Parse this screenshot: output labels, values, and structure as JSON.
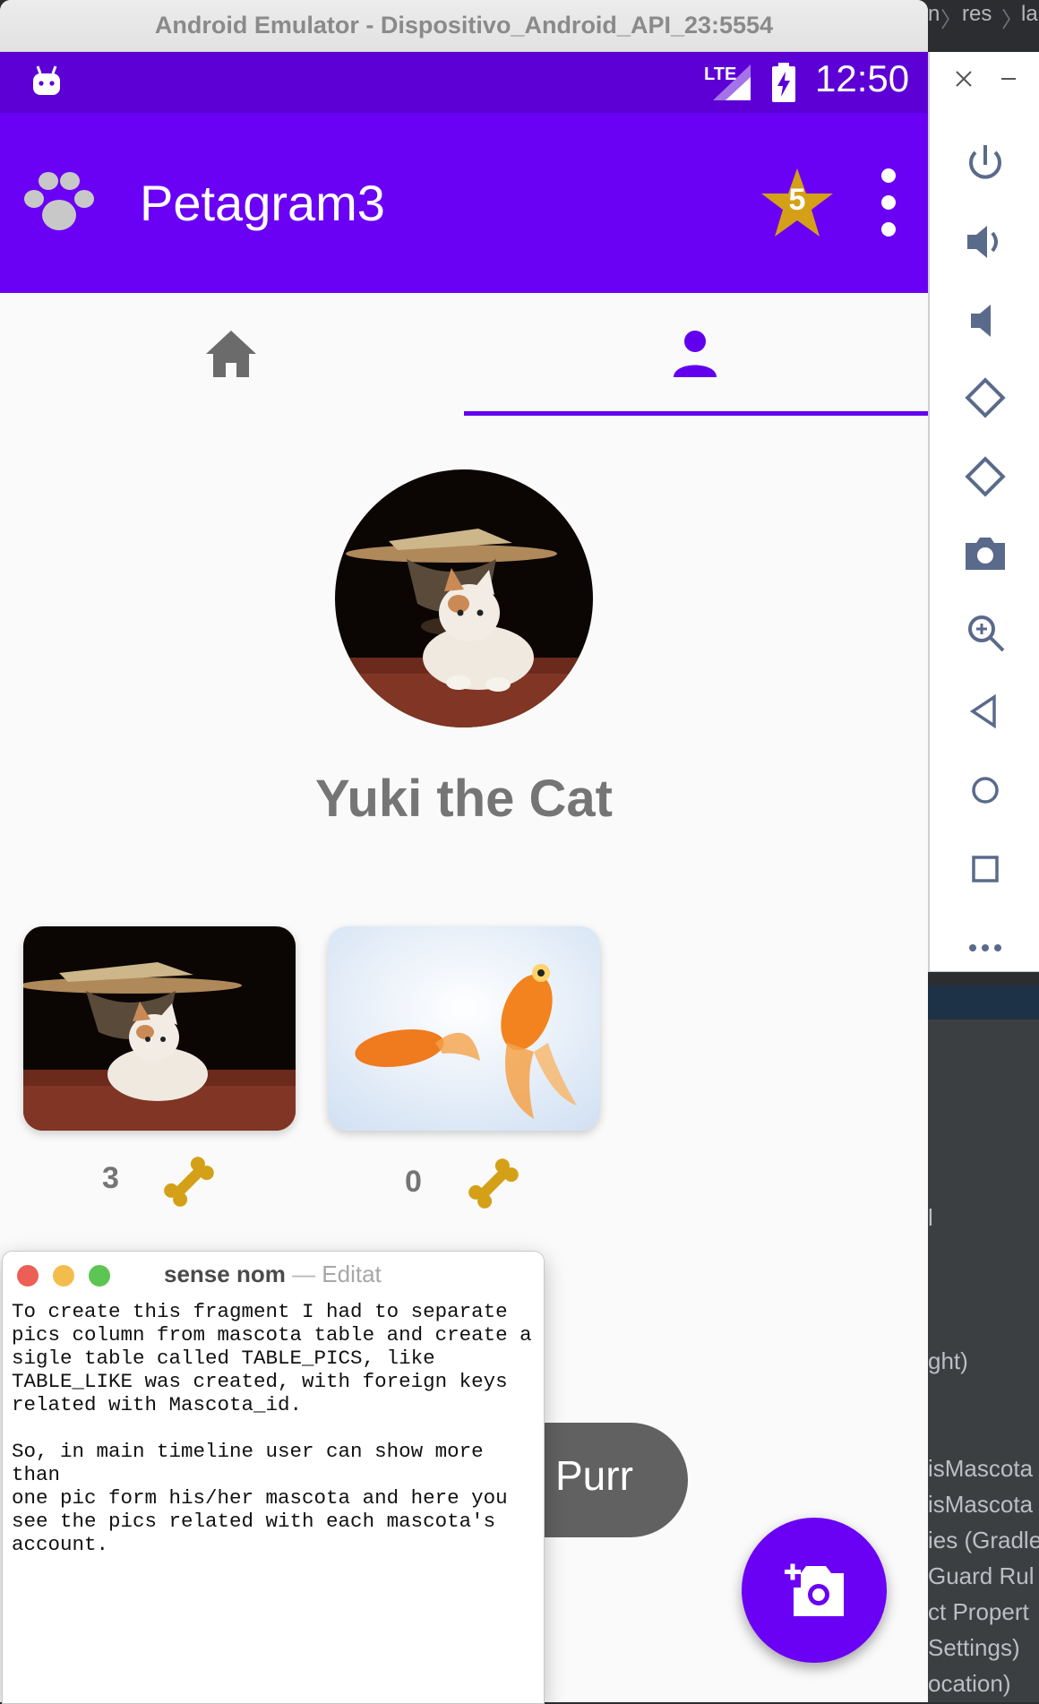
{
  "emulator": {
    "window_title": "Android Emulator - Dispositivo_Android_API_23:5554",
    "status_bar": {
      "network": "LTE",
      "time": "12:50"
    },
    "app_bar": {
      "title": "Petagram3",
      "rating_badge": "5"
    },
    "tabs": [
      {
        "name": "home",
        "icon": "home-icon",
        "selected": false
      },
      {
        "name": "profile",
        "icon": "person-icon",
        "selected": true
      }
    ],
    "profile": {
      "pet_name": "Yuki the Cat"
    },
    "pics": [
      {
        "subject": "kitten",
        "likes": "3"
      },
      {
        "subject": "goldfish",
        "likes": "0"
      }
    ],
    "purr_button": "Purr",
    "colors": {
      "status_bar": "#5c00d6",
      "app_bar": "#6a00f4",
      "accent": "#6200ee",
      "bone": "#d4a017",
      "star": "#d4a017"
    }
  },
  "emulator_toolbar": [
    "power-icon",
    "volume-up-icon",
    "volume-down-icon",
    "rotate-left-icon",
    "rotate-right-icon",
    "camera-icon",
    "zoom-icon",
    "back-icon",
    "home-icon",
    "overview-icon",
    "more-icon"
  ],
  "ide": {
    "breadcrumb": [
      "n",
      "res",
      "la"
    ],
    "lines": [
      "l",
      "ght)",
      "isMascota",
      "isMascota",
      "ies (Gradle",
      "Guard Rul",
      "ct Propert",
      "Settings)",
      "ocation)"
    ]
  },
  "notes": {
    "title": "sense nom",
    "separator": "—",
    "status": "Editat",
    "text": "To create this fragment I had to separate\npics column from mascota table and create a\nsigle table called TABLE_PICS, like\nTABLE_LIKE was created, with foreign keys\nrelated with Mascota_id.\n\nSo, in main timeline user can show more than\none pic form his/her mascota and here you\nsee the pics related with each mascota's\naccount."
  }
}
